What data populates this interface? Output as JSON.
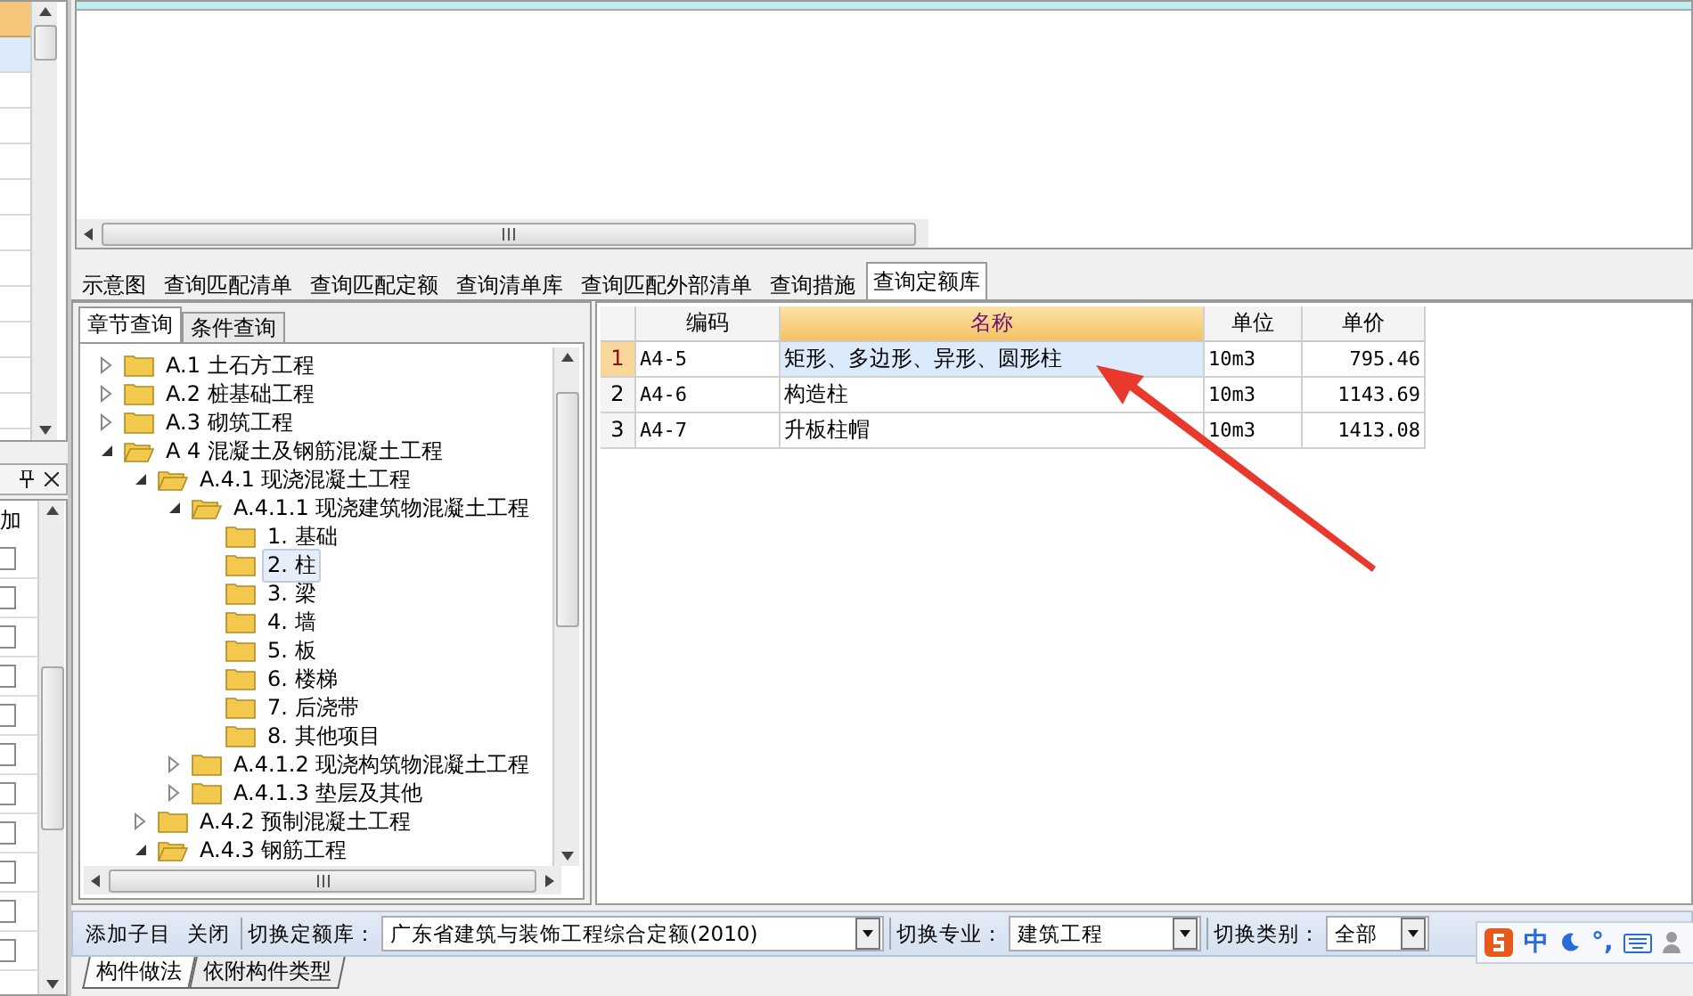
{
  "left_panel": {
    "rows": [
      {
        "selected": true
      },
      {
        "selected": false
      },
      {
        "selected": false
      },
      {
        "selected": false
      },
      {
        "selected": false
      },
      {
        "selected": false
      },
      {
        "selected": false
      },
      {
        "selected": false
      },
      {
        "selected": false
      },
      {
        "selected": false
      },
      {
        "selected": false
      }
    ],
    "header_label": "加",
    "checkboxes": [
      {
        "checked": false
      },
      {
        "checked": false
      },
      {
        "checked": false
      },
      {
        "checked": false
      },
      {
        "checked": false
      },
      {
        "checked": false
      },
      {
        "checked": false
      },
      {
        "checked": false
      },
      {
        "checked": false
      },
      {
        "checked": false
      },
      {
        "checked": false
      }
    ]
  },
  "tabs": [
    {
      "label": "示意图",
      "selected": false
    },
    {
      "label": "查询匹配清单",
      "selected": false
    },
    {
      "label": "查询匹配定额",
      "selected": false
    },
    {
      "label": "查询清单库",
      "selected": false
    },
    {
      "label": "查询匹配外部清单",
      "selected": false
    },
    {
      "label": "查询措施",
      "selected": false
    },
    {
      "label": "查询定额库",
      "selected": true
    }
  ],
  "subtabs": [
    {
      "label": "章节查询",
      "selected": true
    },
    {
      "label": "条件查询",
      "selected": false
    }
  ],
  "tree": [
    {
      "label": "A.1 土石方工程",
      "expanded": false,
      "selected": false
    },
    {
      "label": "A.2 桩基础工程",
      "expanded": false,
      "selected": false
    },
    {
      "label": "A.3 砌筑工程",
      "expanded": false,
      "selected": false
    },
    {
      "label": "A 4 混凝土及钢筋混凝土工程",
      "expanded": true,
      "selected": false,
      "children": [
        {
          "label": "A.4.1 现浇混凝土工程",
          "expanded": true,
          "selected": false,
          "children": [
            {
              "label": "A.4.1.1 现浇建筑物混凝土工程",
              "expanded": true,
              "selected": false,
              "children": [
                {
                  "label": "1. 基础",
                  "selected": false
                },
                {
                  "label": "2. 柱",
                  "selected": true
                },
                {
                  "label": "3. 梁",
                  "selected": false
                },
                {
                  "label": "4. 墙",
                  "selected": false
                },
                {
                  "label": "5. 板",
                  "selected": false
                },
                {
                  "label": "6. 楼梯",
                  "selected": false
                },
                {
                  "label": "7. 后浇带",
                  "selected": false
                },
                {
                  "label": "8. 其他项目",
                  "selected": false
                }
              ]
            },
            {
              "label": "A.4.1.2 现浇构筑物混凝土工程",
              "expanded": false,
              "selected": false
            },
            {
              "label": "A.4.1.3 垫层及其他",
              "expanded": false,
              "selected": false
            }
          ]
        },
        {
          "label": "A.4.2 预制混凝土工程",
          "expanded": false,
          "selected": false
        },
        {
          "label": "A.4.3 钢筋工程",
          "expanded": true,
          "selected": false
        }
      ]
    }
  ],
  "table": {
    "columns": [
      {
        "label": "编码",
        "selected": false
      },
      {
        "label": "名称",
        "selected": true
      },
      {
        "label": "单位",
        "selected": false
      },
      {
        "label": "单价",
        "selected": false
      }
    ],
    "rows": [
      {
        "index": "1",
        "code": "A4-5",
        "name": "矩形、多边形、异形、圆形柱",
        "unit": "10m3",
        "price": "795.46",
        "selected": true
      },
      {
        "index": "2",
        "code": "A4-6",
        "name": "构造柱",
        "unit": "10m3",
        "price": "1143.69",
        "selected": false
      },
      {
        "index": "3",
        "code": "A4-7",
        "name": "升板柱帽",
        "unit": "10m3",
        "price": "1413.08",
        "selected": false
      }
    ]
  },
  "toolbar": {
    "buttons": [
      "添加子目",
      "关闭"
    ],
    "selects": [
      {
        "label": "切换定额库：",
        "value": "广东省建筑与装饰工程综合定额(2010)"
      },
      {
        "label": "切换专业：",
        "value": "建筑工程"
      },
      {
        "label": "切换类别：",
        "value": "全部"
      }
    ]
  },
  "bottom_tabs": [
    {
      "label": "构件做法",
      "selected": true
    },
    {
      "label": "依附构件类型",
      "selected": false
    }
  ],
  "ime": {
    "mode": "中",
    "punct": "°,"
  }
}
